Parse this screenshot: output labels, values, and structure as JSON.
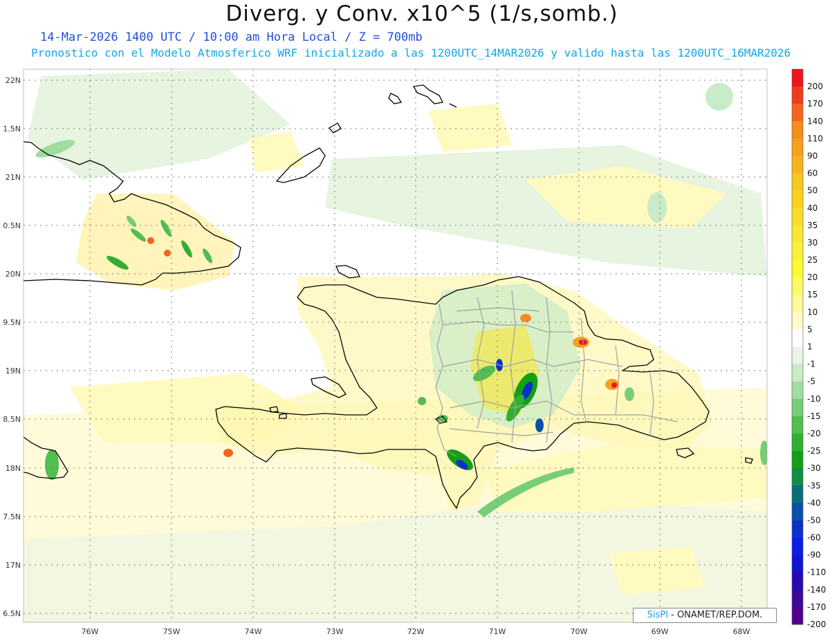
{
  "header": {
    "title": "Diverg. y Conv. x10^5 (1/s,somb.)",
    "subtitle": "14-Mar-2026  1400 UTC / 10:00 am Hora Local / Z = 700mb",
    "info": "Pronostico con el Modelo Atmosferico WRF inicializado a las 1200UTC_14MAR2026 y valido hasta las  1200UTC_16MAR2026"
  },
  "axes": {
    "lat_labels": [
      "22N",
      "1.5N",
      "21N",
      "0.5N",
      "20N",
      "9.5N",
      "19N",
      "8.5N",
      "18N",
      "7.5N",
      "17N",
      "6.5N"
    ],
    "lon_labels": [
      "76W",
      "75W",
      "74W",
      "73W",
      "72W",
      "71W",
      "70W",
      "69W",
      "68W"
    ]
  },
  "colorbar": {
    "labels": [
      "200",
      "170",
      "140",
      "110",
      "90",
      "60",
      "50",
      "40",
      "35",
      "30",
      "25",
      "20",
      "15",
      "10",
      "5",
      "1",
      "-1",
      "-5",
      "-10",
      "-15",
      "-20",
      "-25",
      "-30",
      "-35",
      "-40",
      "-50",
      "-60",
      "-90",
      "-110",
      "-140",
      "-170",
      "-200"
    ],
    "colors": [
      "#f0141e",
      "#f03c1e",
      "#f5641e",
      "#f58c1e",
      "#f5a01e",
      "#f5b41e",
      "#f5c81e",
      "#fad21e",
      "#fadc28",
      "#fae632",
      "#faf03c",
      "#fffa32",
      "#fffa64",
      "#fffa96",
      "#fffac8",
      "#ffffff",
      "#e8f5e4",
      "#c8ebc8",
      "#a0dca0",
      "#78cd78",
      "#50be50",
      "#32af32",
      "#14a014",
      "#128c46",
      "#0a6e78",
      "#0a50aa",
      "#0a32c8",
      "#0a1ee6",
      "#1414d2",
      "#280ab4",
      "#3c0a96",
      "#50008c"
    ]
  },
  "credit": {
    "brand": "SisPI",
    "org": " - ONAMET/REP.DOM."
  }
}
